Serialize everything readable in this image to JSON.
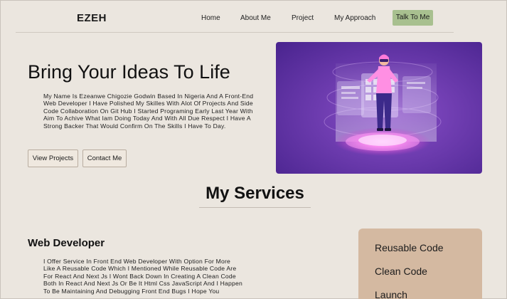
{
  "nav": {
    "brand": "EZEH",
    "links": [
      "Home",
      "About Me",
      "Project",
      "My Approach"
    ],
    "cta": "Talk To Me"
  },
  "hero": {
    "title": "Bring Your Ideas To Life",
    "text": "My Name Is Ezeanwe Chigozie Godwin Based In Nigeria And A Front-End Web Developer I Have Polished My Skilles With Alot Of Projects And Side Code Collaboration On Git Hub I Started Programing Early Last Year With Aim To Achive What Iam Doing Today And With All Due Respect I Have A Strong Backer That Would Confirm On The Skills I Have To Day.",
    "btn_projects": "View Projects",
    "btn_contact": "Contact Me",
    "image_icon": "vr-developer-illustration"
  },
  "services": {
    "title": "My Services",
    "heading": "Web Developer",
    "text": "I Offer Service In Front End Web Developer With Option For More Like A Reusable Code Which I Mentioned While Reusable Code Are For React And Next Js I Wont Back Down In Creating A Clean Code Both In React And Next Js Or Be It Html Css JavaScript And I Happen To Be Maintaining And Debugging Front End Bugs I Hope You",
    "side_items": [
      "Reusable Code",
      "Clean Code",
      "Launch"
    ]
  },
  "colors": {
    "background": "#ebe6df",
    "cta": "#a8c08f",
    "card": "#d4b9a1",
    "art_purple": "#6b3aa8"
  }
}
